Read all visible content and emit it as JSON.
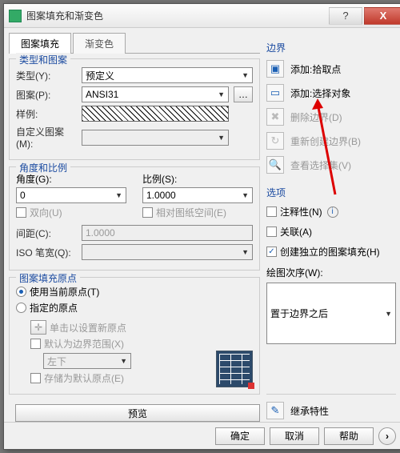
{
  "window": {
    "title": "图案填充和渐变色"
  },
  "tabs": {
    "hatch": "图案填充",
    "gradient": "渐变色"
  },
  "typeAndPattern": {
    "title": "类型和图案",
    "typeLabel": "类型(Y):",
    "typeValue": "预定义",
    "patternLabel": "图案(P):",
    "patternValue": "ANSI31",
    "sampleLabel": "样例:",
    "customLabel": "自定义图案(M):"
  },
  "angleScale": {
    "title": "角度和比例",
    "angleLabel": "角度(G):",
    "angleValue": "0",
    "scaleLabel": "比例(S):",
    "scaleValue": "1.0000",
    "double": "双向(U)",
    "relative": "相对图纸空间(E)",
    "spacingLabel": "间距(C):",
    "spacingValue": "1.0000",
    "isoPenLabel": "ISO 笔宽(Q):"
  },
  "origin": {
    "title": "图案填充原点",
    "useCurrent": "使用当前原点(T)",
    "specified": "指定的原点",
    "clickNew": "单击以设置新原点",
    "defaultExtent": "默认为边界范围(X)",
    "position": "左下",
    "storeDefault": "存储为默认原点(E)"
  },
  "boundary": {
    "title": "边界",
    "addPick": "添加:拾取点",
    "addSelect": "添加:选择对象",
    "remove": "删除边界(D)",
    "recreate": "重新创建边界(B)",
    "viewSel": "查看选择集(V)"
  },
  "options": {
    "title": "选项",
    "annotative": "注释性(N)",
    "assoc": "关联(A)",
    "separate": "创建独立的图案填充(H)",
    "drawOrderLabel": "绘图次序(W):",
    "drawOrderValue": "置于边界之后"
  },
  "inherit": "继承特性",
  "footer": {
    "preview": "预览",
    "ok": "确定",
    "cancel": "取消",
    "help": "帮助"
  }
}
